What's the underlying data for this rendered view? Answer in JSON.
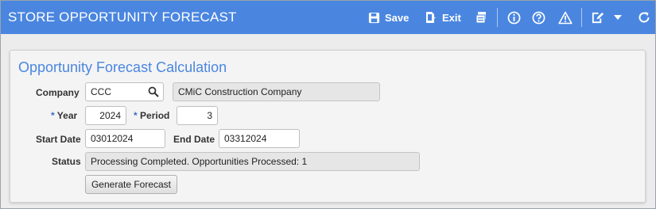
{
  "header": {
    "title": "STORE OPPORTUNITY FORECAST",
    "save_label": "Save",
    "exit_label": "Exit",
    "icons": [
      "save-icon",
      "exit-icon",
      "print-icon",
      "info-icon",
      "help-icon",
      "warning-icon",
      "edit-icon",
      "chevron-down-icon",
      "refresh-icon"
    ]
  },
  "panel": {
    "title": "Opportunity Forecast Calculation"
  },
  "form": {
    "company_label": "Company",
    "company_code": "CCC",
    "company_name": "CMiC Construction Company",
    "required_marker": "*",
    "year_label": "Year",
    "year_value": "2024",
    "period_label": "Period",
    "period_value": "3",
    "start_date_label": "Start Date",
    "start_date_value": "03012024",
    "end_date_label": "End Date",
    "end_date_value": "03312024",
    "status_label": "Status",
    "status_value": "Processing Completed. Opportunities Processed: 1",
    "generate_button": "Generate Forecast"
  },
  "colors": {
    "header_bg": "#4a86e0",
    "accent": "#4a86e0"
  }
}
